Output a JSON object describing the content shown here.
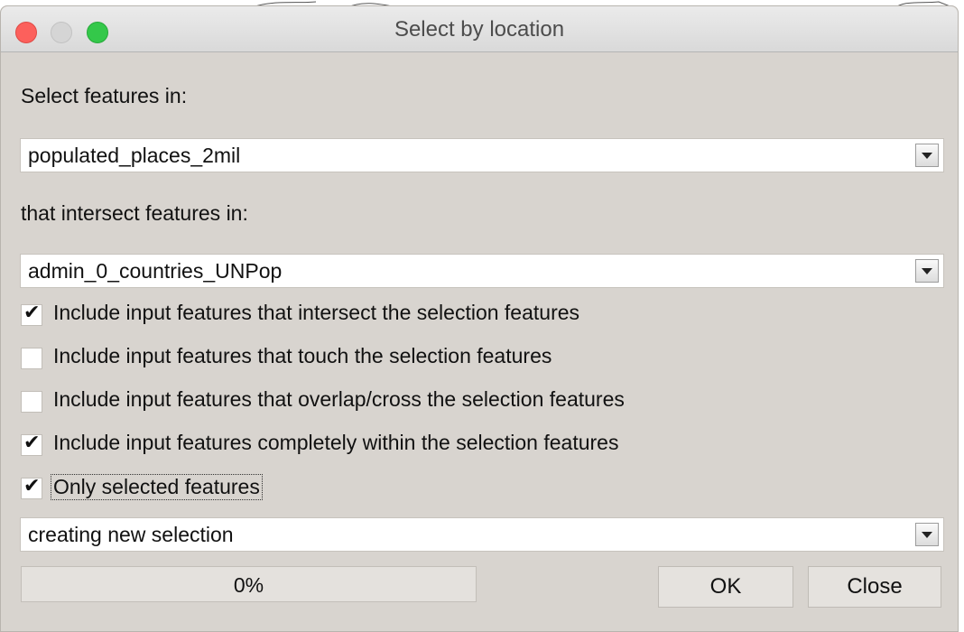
{
  "window": {
    "title": "Select by location"
  },
  "form": {
    "select_label": "Select features in:",
    "select_value": "populated_places_2mil",
    "intersect_label": "that intersect features in:",
    "intersect_value": "admin_0_countries_UNPop",
    "options": [
      {
        "label": "Include input features that intersect the selection features",
        "checked": true
      },
      {
        "label": "Include input features that touch the selection features",
        "checked": false
      },
      {
        "label": "Include input features that overlap/cross the selection features",
        "checked": false
      },
      {
        "label": "Include input features completely within the selection features",
        "checked": true
      },
      {
        "label": "Only selected features",
        "checked": true
      }
    ],
    "mode_value": "creating new selection"
  },
  "footer": {
    "progress": 0,
    "progress_text": "0%",
    "ok_label": "OK",
    "close_label": "Close"
  },
  "icons": {
    "check": "✔",
    "dropdown": "chevron-down-icon"
  },
  "colors": {
    "close_button": "#fc605c",
    "minimize_button": "#d5d5d5",
    "maximize_button": "#34c84a",
    "dialog_bg": "#d8d4cf"
  }
}
